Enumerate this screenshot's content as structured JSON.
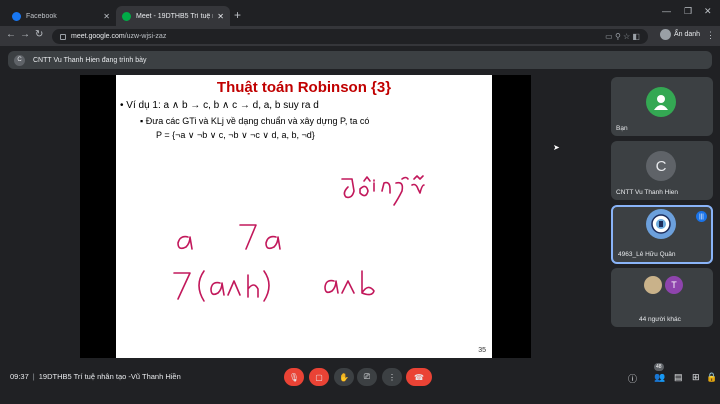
{
  "browser": {
    "tabs": [
      {
        "title": "Facebook",
        "color": "#1877f2",
        "active": false
      },
      {
        "title": "Meet - 19DTHB5 Trí tuệ nhân tạo",
        "color": "#00ac47",
        "active": true
      }
    ],
    "url_domain": "meet.google.com",
    "url_path": "/uzw-wjsi-zaz",
    "profile_label": "Ẩn danh",
    "new_tab_icon": "plus-icon"
  },
  "meet": {
    "presenting_text": "CNTT Vu Thanh Hien đang trình bày",
    "presenter_initial": "C",
    "slide": {
      "title": "Thuật toán Robinson {3}",
      "bullet1": "•  Ví dụ 1: a ∧ b → c, b ∧ c → d, a, b suy ra d",
      "bullet2": "▪  Đưa các GTi và KLj về dạng chuẩn và xây dựng P,  ta có",
      "bullet3": "P = {¬a ∨ ¬b ∨ c, ¬b ∨ ¬c ∨ d, a, b, ¬d}",
      "page_number": "35",
      "handwriting": [
        "đối ngẫu",
        "a",
        "7a",
        "7(a∧b)",
        "a∧b"
      ]
    },
    "participants": [
      {
        "name": "Bạn",
        "initial": "",
        "color": "#34a853",
        "icon": "person-icon"
      },
      {
        "name": "CNTT Vu Thanh Hien",
        "initial": "C",
        "color": "#5f6368"
      },
      {
        "name": "4963_Lê Hữu Quân",
        "initial": "",
        "color": "#6ca0dc",
        "icon": "crest-icon",
        "speaking": true
      },
      {
        "name": "44 người khác",
        "initial": "T",
        "color": "#8e44ad"
      }
    ],
    "time": "09:37",
    "meeting_name": "19DTHB5 Trí tuệ nhân tạo -Vũ Thanh Hiền",
    "controls": [
      "mic-off",
      "camera-off",
      "raise-hand",
      "present",
      "more",
      "hang-up"
    ],
    "people_count": "48"
  }
}
